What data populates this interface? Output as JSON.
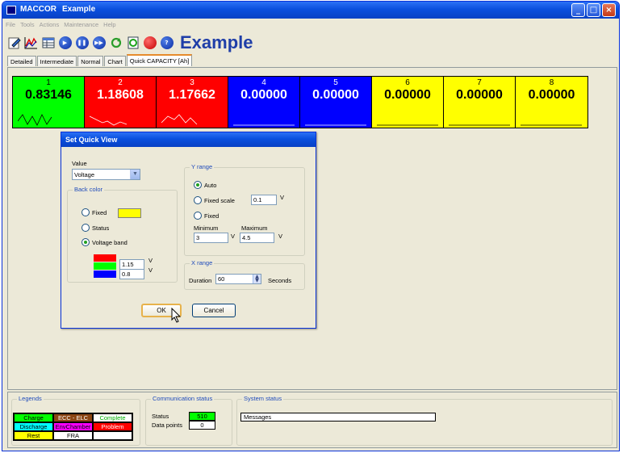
{
  "window": {
    "app": "MACCOR",
    "doc": "Example"
  },
  "menu": [
    "File",
    "Tools",
    "Actions",
    "Maintenance",
    "Help"
  ],
  "toolbar": {
    "title": "Example"
  },
  "tabs": [
    {
      "label": "Detailed",
      "active": false
    },
    {
      "label": "Intermediate",
      "active": false
    },
    {
      "label": "Normal",
      "active": false
    },
    {
      "label": "Chart",
      "active": false
    },
    {
      "label": "Quick CAPACITY [Ah]",
      "active": true
    }
  ],
  "channels": [
    {
      "num": "1",
      "value": "0.83146",
      "bg": "#00ff00",
      "color": "#000000"
    },
    {
      "num": "2",
      "value": "1.18608",
      "bg": "#ff0000",
      "color": "#ffffff"
    },
    {
      "num": "3",
      "value": "1.17662",
      "bg": "#ff0000",
      "color": "#ffffff"
    },
    {
      "num": "4",
      "value": "0.00000",
      "bg": "#0000ff",
      "color": "#ffffff"
    },
    {
      "num": "5",
      "value": "0.00000",
      "bg": "#0000ff",
      "color": "#ffffff"
    },
    {
      "num": "6",
      "value": "0.00000",
      "bg": "#ffff00",
      "color": "#000000"
    },
    {
      "num": "7",
      "value": "0.00000",
      "bg": "#ffff00",
      "color": "#000000"
    },
    {
      "num": "8",
      "value": "0.00000",
      "bg": "#ffff00",
      "color": "#000000"
    }
  ],
  "dialog": {
    "title": "Set Quick View",
    "value_label": "Value",
    "value_selected": "Voltage",
    "back_color": {
      "group_label": "Back color",
      "fixed": "Fixed",
      "status": "Status",
      "voltage_band": "Voltage band",
      "selected": "voltage_band",
      "fixed_color": "#ffff00",
      "band_colors": [
        "#ff0000",
        "#00ff00",
        "#0000ff"
      ],
      "upper": "1.15",
      "lower": "0.8",
      "unit": "V"
    },
    "y_range": {
      "group_label": "Y range",
      "auto": "Auto",
      "fixed_scale": "Fixed scale",
      "fixed_scale_value": "0.1",
      "fixed": "Fixed",
      "selected": "auto",
      "min_label": "Minimum",
      "max_label": "Maximum",
      "min_value": "3",
      "max_value": "4.5",
      "unit": "V"
    },
    "x_range": {
      "group_label": "X range",
      "duration_label": "Duration",
      "duration_value": "60",
      "unit": "Seconds"
    },
    "ok": "OK",
    "cancel": "Cancel"
  },
  "legends": {
    "title": "Legends",
    "items": [
      {
        "label": "Charge",
        "bg": "#00ff00",
        "color": "#000000"
      },
      {
        "label": "ECC - ELC",
        "bg": "#8b4513",
        "color": "#ffffff"
      },
      {
        "label": "Complete",
        "bg": "#ffffff",
        "color": "#00b000"
      },
      {
        "label": "Discharge",
        "bg": "#00ffff",
        "color": "#000000"
      },
      {
        "label": "EnvChamber",
        "bg": "#ff00ff",
        "color": "#000000"
      },
      {
        "label": "Problem",
        "bg": "#ff0000",
        "color": "#ffffff"
      },
      {
        "label": "Rest",
        "bg": "#ffff00",
        "color": "#000000"
      },
      {
        "label": "FRA",
        "bg": "#ffffff",
        "color": "#000000"
      },
      {
        "label": "",
        "bg": "#ffffff",
        "color": "#000000"
      }
    ]
  },
  "comm": {
    "title": "Communication status",
    "status_label": "Status",
    "status_value": "510",
    "points_label": "Data points",
    "points_value": "0"
  },
  "system": {
    "title": "System status",
    "messages": "Messages"
  }
}
